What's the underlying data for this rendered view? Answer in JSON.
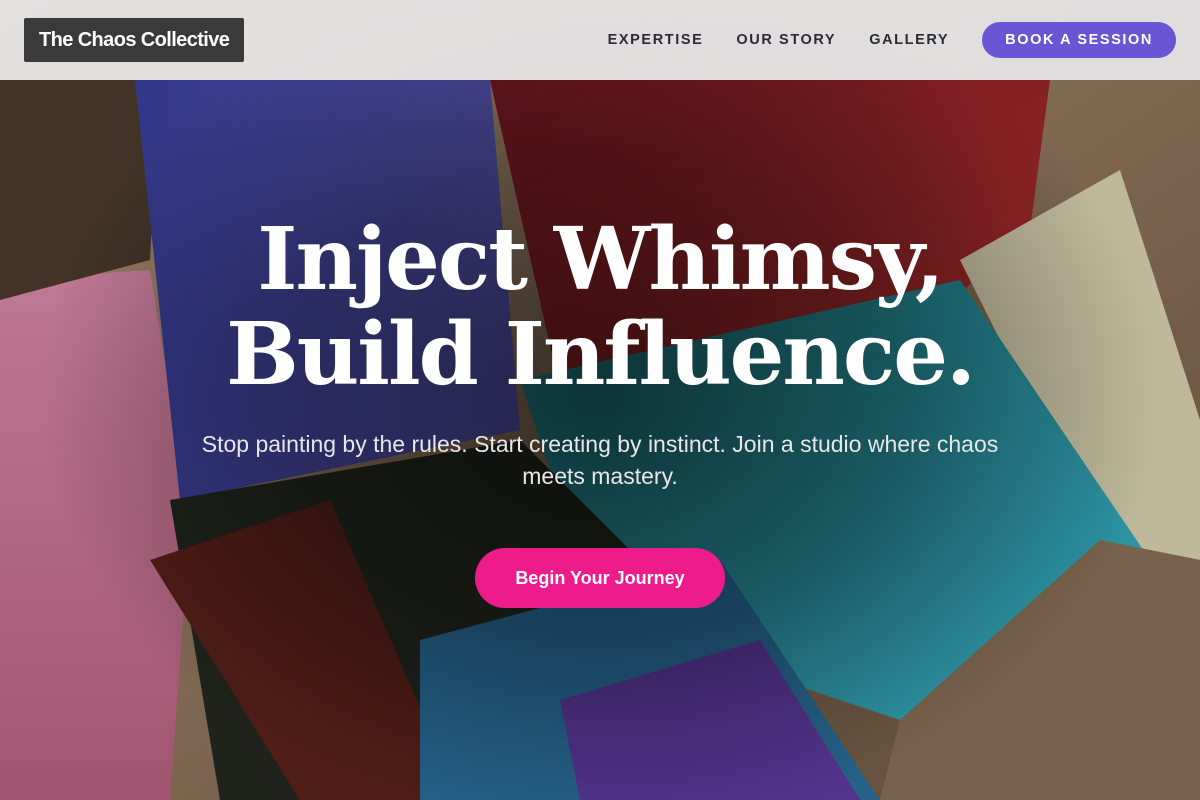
{
  "header": {
    "logo_text": "The Chaos Collective",
    "nav": [
      {
        "label": "EXPERTISE"
      },
      {
        "label": "OUR STORY"
      },
      {
        "label": "GALLERY"
      }
    ],
    "cta_label": "BOOK A SESSION"
  },
  "hero": {
    "title_line_1": "Inject Whimsy,",
    "title_line_2": "Build Influence.",
    "subtitle": "Stop painting by the rules. Start creating by instinct. Join a studio where chaos meets mastery.",
    "cta_label": "Begin Your Journey",
    "background_image": "paint-brushes-photo"
  },
  "colors": {
    "header_bg": "#e8e6e8",
    "logo_bg": "#3a3a3a",
    "nav_cta_bg": "#6a55d4",
    "hero_cta_bg": "#ee1c8a",
    "nav_text": "#2a2a36"
  }
}
